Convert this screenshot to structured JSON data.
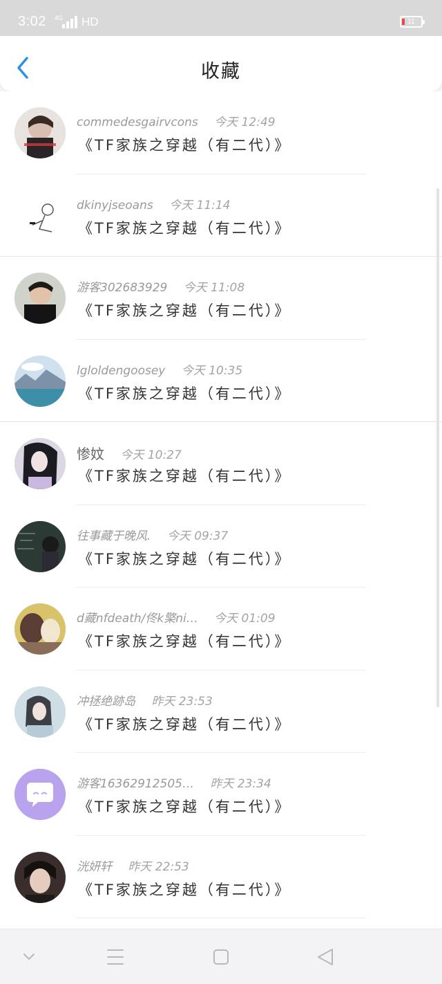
{
  "status_bar": {
    "time": "3:02",
    "network": "4G",
    "hd": "HD",
    "battery": "11"
  },
  "header": {
    "title": "收藏"
  },
  "items": [
    {
      "name": "commedesgairvcons",
      "time": "今天 12:49",
      "title": "《TF家族之穿越（有二代）》"
    },
    {
      "name": "dkinyjseoans",
      "time": "今天 11:14",
      "title": "《TF家族之穿越（有二代）》"
    },
    {
      "name": "游客302683929",
      "time": "今天 11:08",
      "title": "《TF家族之穿越（有二代）》"
    },
    {
      "name": "lgloldengoosey",
      "time": "今天 10:35",
      "title": "《TF家族之穿越（有二代）》"
    },
    {
      "name": "惨妏",
      "time": "今天 10:27",
      "title": "《TF家族之穿越（有二代）》"
    },
    {
      "name": "往事藏于晚风.",
      "time": "今天 09:37",
      "title": "《TF家族之穿越（有二代）》"
    },
    {
      "name": "d藏nfdeath/佟k檠ni…",
      "time": "今天 01:09",
      "title": "《TF家族之穿越（有二代）》"
    },
    {
      "name": "冲拯绝跡岛",
      "time": "昨天 23:53",
      "title": "《TF家族之穿越（有二代）》"
    },
    {
      "name": "游客16362912505…",
      "time": "昨天 23:34",
      "title": "《TF家族之穿越（有二代）》"
    },
    {
      "name": "洸妍轩",
      "time": "昨天 22:53",
      "title": "《TF家族之穿越（有二代）》"
    }
  ],
  "avatar_icons": [
    "avatar-photo-icon",
    "avatar-sketch-icon",
    "avatar-photo-icon",
    "avatar-lake-icon",
    "avatar-photo-icon",
    "avatar-photo-icon",
    "avatar-photo-icon",
    "avatar-photo-icon",
    "avatar-chat-icon",
    "avatar-photo-icon"
  ],
  "colors": {
    "accent": "#2f90e4",
    "status_bar": "#d9d9d9",
    "battery_low": "#e24b4b"
  }
}
